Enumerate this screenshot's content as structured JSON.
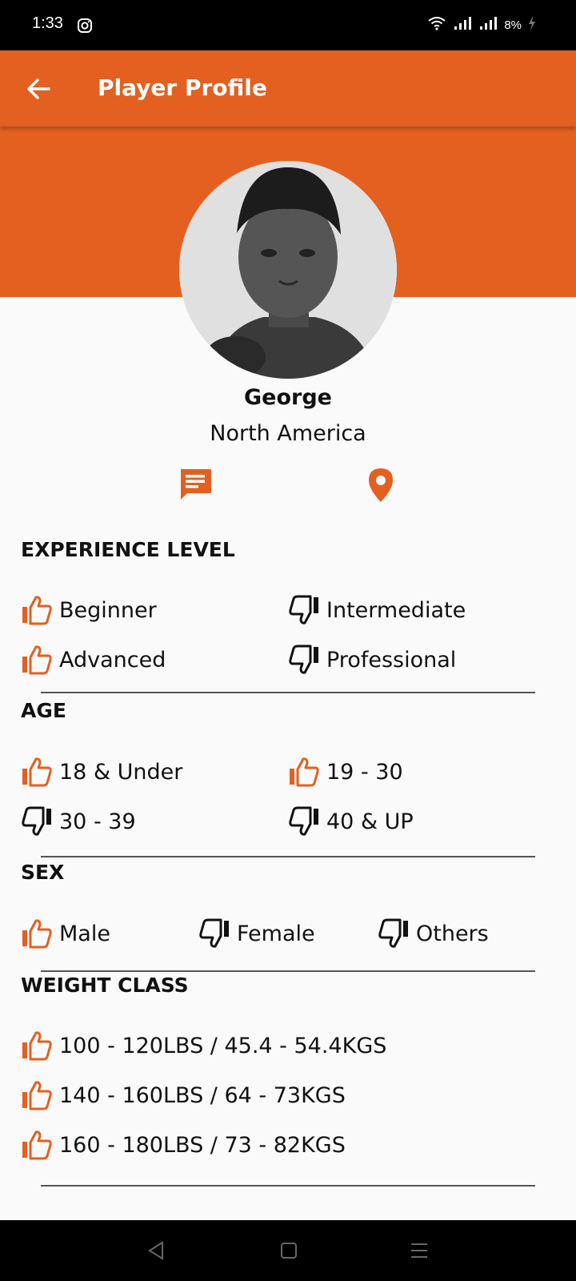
{
  "status": {
    "time": "1:33",
    "battery": "8%"
  },
  "header": {
    "title": "Player Profile"
  },
  "profile": {
    "name": "George",
    "region": "North America"
  },
  "sections": {
    "experience": {
      "title": "EXPERIENCE LEVEL",
      "items": [
        {
          "label": "Beginner",
          "liked": true
        },
        {
          "label": "Intermediate",
          "liked": false
        },
        {
          "label": "Advanced",
          "liked": true
        },
        {
          "label": "Professional",
          "liked": false
        }
      ]
    },
    "age": {
      "title": "AGE",
      "items": [
        {
          "label": "18 & Under",
          "liked": true
        },
        {
          "label": "19 - 30",
          "liked": true
        },
        {
          "label": "30 - 39",
          "liked": false
        },
        {
          "label": "40 & UP",
          "liked": false
        }
      ]
    },
    "sex": {
      "title": "SEX",
      "items": [
        {
          "label": "Male",
          "liked": true
        },
        {
          "label": "Female",
          "liked": false
        },
        {
          "label": "Others",
          "liked": false
        }
      ]
    },
    "weight": {
      "title": "WEIGHT CLASS",
      "items": [
        {
          "label": "100 - 120LBS / 45.4 - 54.4KGS",
          "liked": true
        },
        {
          "label": "140 - 160LBS / 64 - 73KGS",
          "liked": true
        },
        {
          "label": "160 - 180LBS / 73 - 82KGS",
          "liked": true
        }
      ]
    }
  },
  "icons": {
    "back": "arrow-left-icon",
    "chat": "chat-bubble-icon",
    "location": "map-pin-icon",
    "like": "thumbs-up-icon",
    "dislike": "thumbs-down-icon"
  },
  "colors": {
    "accent": "#e36021",
    "text": "#111111",
    "background": "#fafafa"
  }
}
